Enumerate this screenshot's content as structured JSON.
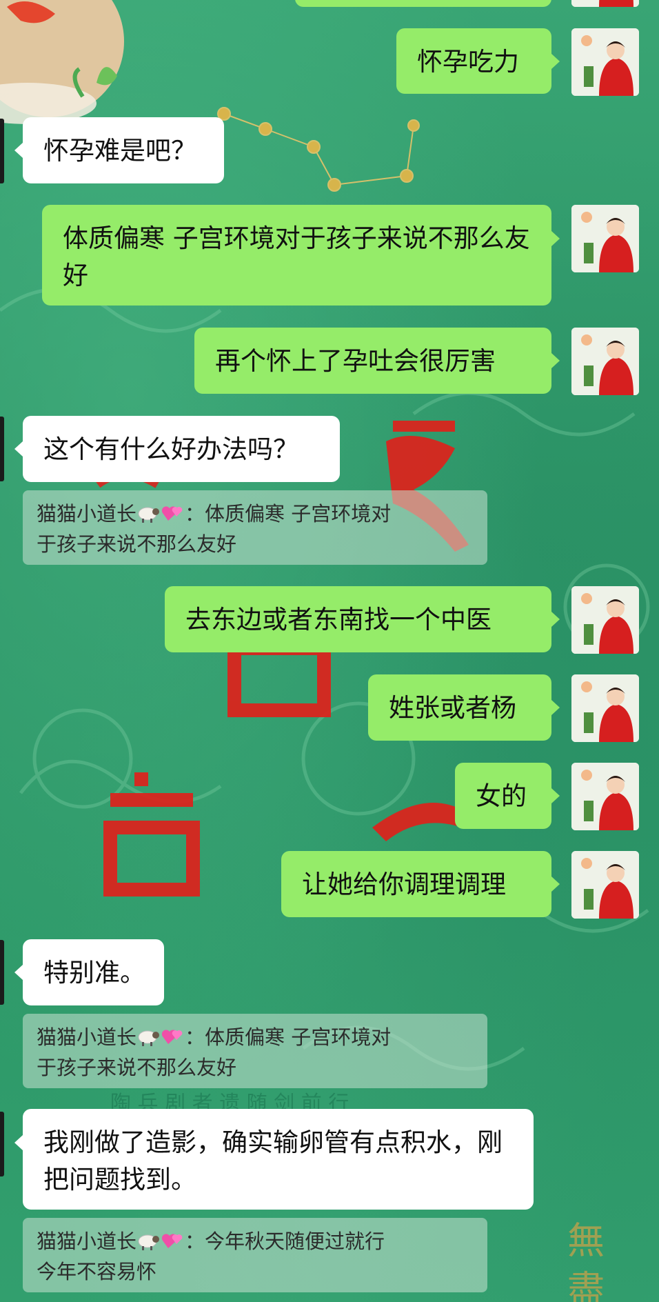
{
  "theme": {
    "self_bubble": "#95ec69",
    "other_bubble": "#ffffff",
    "background": "#2f9a6c",
    "quote_bg": "rgba(200,225,210,0.55)"
  },
  "messages": [
    {
      "from": "me",
      "text": "怀孕吃力"
    },
    {
      "from": "other",
      "text": "怀孕难是吧？"
    },
    {
      "from": "me",
      "text": "体质偏寒  子宫环境对于孩子来说不那么友好"
    },
    {
      "from": "me",
      "text": "再个怀上了孕吐会很厉害"
    },
    {
      "from": "other",
      "text": "这个有什么好办法吗？"
    },
    {
      "from": "me",
      "text": "去东边或者东南找一个中医"
    },
    {
      "from": "me",
      "text": "姓张或者杨"
    },
    {
      "from": "me",
      "text": "女的"
    },
    {
      "from": "me",
      "text": "让她给你调理调理"
    },
    {
      "from": "other",
      "text": "特别准。"
    },
    {
      "from": "other",
      "text": "我刚做了造影，确实输卵管有点积水，刚把问题找到。"
    }
  ],
  "quotes": [
    {
      "name": "猫猫小道长",
      "emoji": [
        "sheep-icon",
        "hearts-icon"
      ],
      "sep": "：",
      "line1": "体质偏寒  子宫环境对",
      "line2": "于孩子来说不那么友好"
    },
    {
      "name": "猫猫小道长",
      "emoji": [
        "sheep-icon",
        "hearts-icon"
      ],
      "sep": "：",
      "line1": "体质偏寒  子宫环境对",
      "line2": "于孩子来说不那么友好"
    },
    {
      "name": "猫猫小道长",
      "emoji": [
        "sheep-icon",
        "hearts-icon"
      ],
      "sep": "：",
      "line1": "今年秋天随便过就行",
      "line2": "今年不容易怀"
    }
  ],
  "background_text": {
    "watermark_line": "陶 兵 剧 者 遗 随 剑 前 行",
    "seal_chars": "無 盡"
  }
}
